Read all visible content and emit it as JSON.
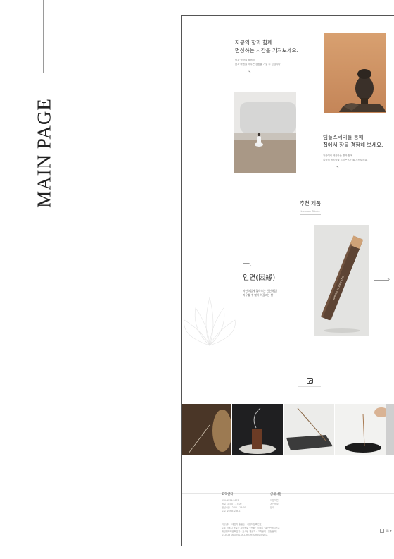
{
  "page": {
    "side_title": "MAIN PAGE"
  },
  "intro": {
    "heading_line1": "자공의 향과 함께",
    "heading_line2": "명상하는 시간을 가져보세요.",
    "desc_line1": "향과 명상을 함께 하",
    "desc_line2": "몸과 마음을 비우는 경험을 가질 수 있습니다."
  },
  "temple": {
    "heading_line1": "템플스테이를 통해",
    "heading_line2": "집에서 향을 경험해 보세요.",
    "desc_line1": "자공에서 제공하는 향과 함께",
    "desc_line2": "일상의 평온함을 느끼는 시간을 가져보세요."
  },
  "recommend": {
    "title": "추천 제품",
    "subtitle": "Incense Sticks"
  },
  "product": {
    "mark": "一.",
    "name": "인연(因緣)",
    "desc_line1": "자연스럽게 닿아오는 인연처럼",
    "desc_line2": "자유할 수 없이 이끌리는 향",
    "tube_text": "NATURAL INCENSE STICK"
  },
  "footer": {
    "col1_head": "고객센터",
    "col1_lines": [
      "070-1234-5678",
      "평일 10:00 - 17:00",
      "점심시간 12:00 - 13:00",
      "주말 및 공휴일 휴무"
    ],
    "col2_head": "상세사항",
    "col2_lines": [
      "이용약관",
      "개인정보",
      "안내"
    ],
    "info_line1": "자공(주) · 대표자 홍길동 · 사업자등록번호",
    "info_line2": "주소 서울시 종로구 자하문로 · 전화 · 이메일 · 통신판매업신고",
    "info_line3": "개인정보보호책임자 · 호스팅 제공자 · 고객문의 · 입점문의",
    "info_line4": "© 2023 JAGONG. ALL RIGHTS RESERVED.",
    "lang": "KR"
  },
  "icons": {
    "instagram": "instagram-icon",
    "arrow": "arrow-right-icon"
  }
}
